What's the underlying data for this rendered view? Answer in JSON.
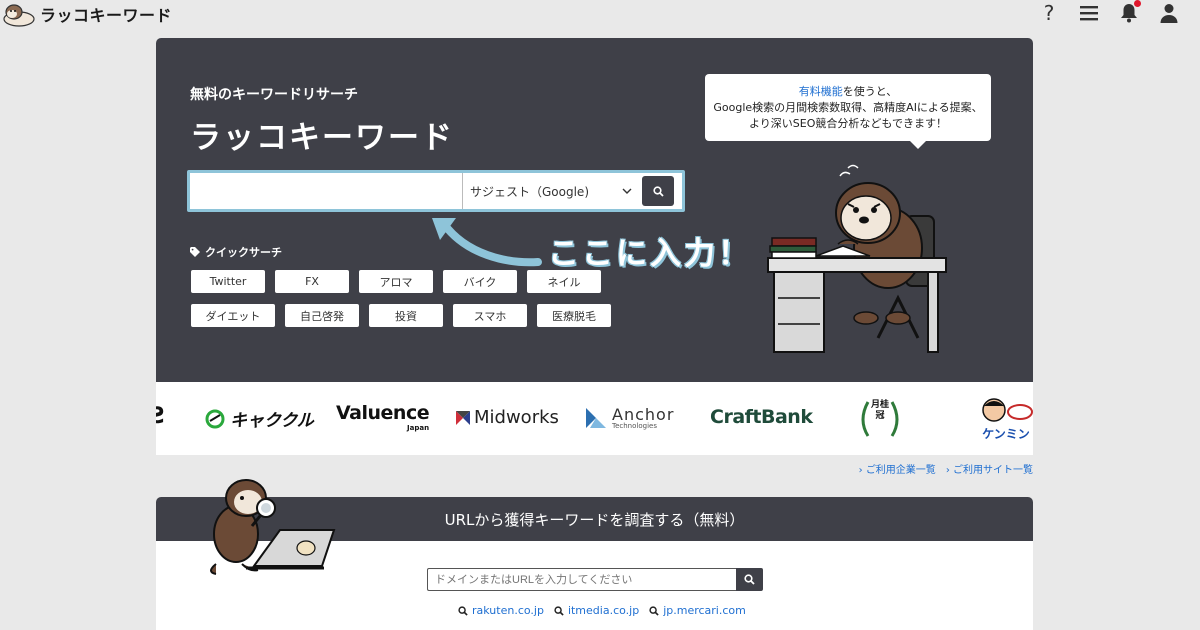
{
  "nav": {
    "logo_text": "ラッコキーワード",
    "icons": [
      "help-icon",
      "menu-icon",
      "bell-icon",
      "user-icon"
    ]
  },
  "hero": {
    "subtitle": "無料のキーワードリサーチ",
    "title": "ラッコキーワード",
    "search": {
      "input_value": "",
      "select_value": "サジェスト（Google)"
    },
    "callout": "ここに入力！",
    "speech": {
      "link": "有料機能",
      "line1_rest": "を使うと、",
      "line2": "Google検索の月間検索数取得、高精度AIによる提案、",
      "line3": "より深いSEO競合分析などもできます！"
    },
    "quick_label": "クイックサーチ",
    "quick_tags": [
      "Twitter",
      "FX",
      "アロマ",
      "バイク",
      "ネイル",
      "ダイエット",
      "自己啓発",
      "投資",
      "スマホ",
      "医療脱毛"
    ]
  },
  "companies": {
    "partial_left": "Ƨ",
    "kyakukuru": "キャククル",
    "valuence": "Valuence",
    "valuence_sub": "Japan",
    "midworks": "Midworks",
    "anchor": "Anchor",
    "anchor_sub": "Technologies",
    "craftbank": "CraftBank",
    "gekkeikan": "月桂冠",
    "kenmin": "ケンミン"
  },
  "used_links": {
    "companies": "ご利用企業一覧",
    "sites": "ご利用サイト一覧"
  },
  "url_section": {
    "header": "URLから獲得キーワードを調査する（無料）",
    "placeholder": "ドメインまたはURLを入力してください",
    "examples": [
      "rakuten.co.jp",
      "itmedia.co.jp",
      "jp.mercari.com"
    ]
  },
  "colors": {
    "hero_bg": "#3f4048",
    "accent_blue": "#1f6fd1",
    "frame_blue": "#8ec4d9",
    "notif_red": "#e0162b"
  }
}
